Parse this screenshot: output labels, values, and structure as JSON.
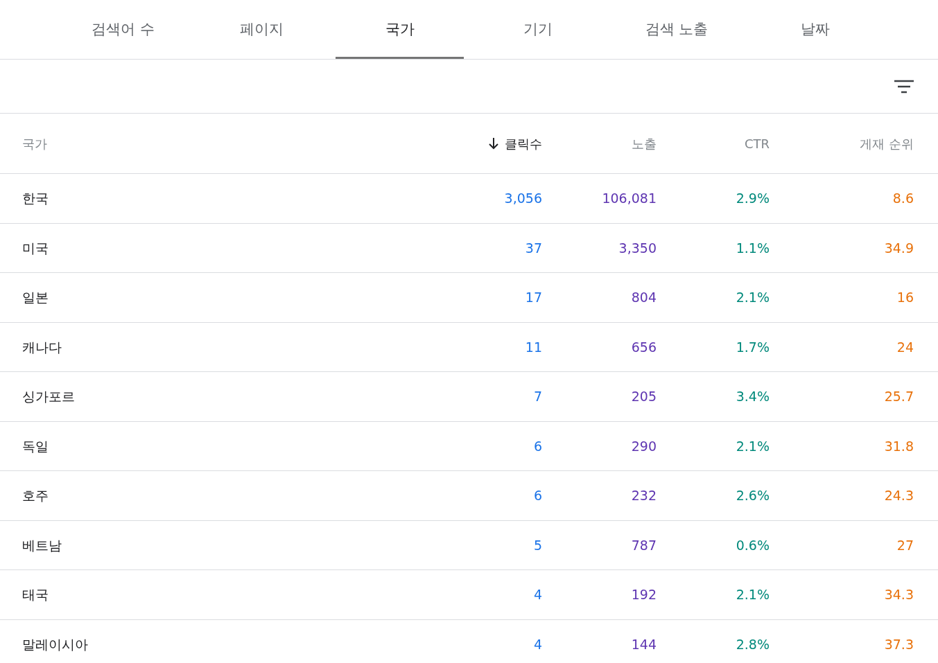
{
  "tabs": [
    {
      "label": "검색어 수",
      "selected": false
    },
    {
      "label": "페이지",
      "selected": false
    },
    {
      "label": "국가",
      "selected": true
    },
    {
      "label": "기기",
      "selected": false
    },
    {
      "label": "검색 노출",
      "selected": false
    },
    {
      "label": "날짜",
      "selected": false
    }
  ],
  "table": {
    "columns": [
      {
        "label": "국가",
        "sorted": false
      },
      {
        "label": "클릭수",
        "sorted": true,
        "color": "#1a73e8"
      },
      {
        "label": "노출",
        "sorted": false,
        "color": "#5e35b1"
      },
      {
        "label": "CTR",
        "sorted": false,
        "color": "#00897b"
      },
      {
        "label": "게재 순위",
        "sorted": false,
        "color": "#e8710a"
      }
    ],
    "rows": [
      [
        "한국",
        "3,056",
        "106,081",
        "2.9%",
        "8.6"
      ],
      [
        "미국",
        "37",
        "3,350",
        "1.1%",
        "34.9"
      ],
      [
        "일본",
        "17",
        "804",
        "2.1%",
        "16"
      ],
      [
        "캐나다",
        "11",
        "656",
        "1.7%",
        "24"
      ],
      [
        "싱가포르",
        "7",
        "205",
        "3.4%",
        "25.7"
      ],
      [
        "독일",
        "6",
        "290",
        "2.1%",
        "31.8"
      ],
      [
        "호주",
        "6",
        "232",
        "2.6%",
        "24.3"
      ],
      [
        "베트남",
        "5",
        "787",
        "0.6%",
        "27"
      ],
      [
        "태국",
        "4",
        "192",
        "2.1%",
        "34.3"
      ],
      [
        "말레이시아",
        "4",
        "144",
        "2.8%",
        "37.3"
      ]
    ]
  }
}
